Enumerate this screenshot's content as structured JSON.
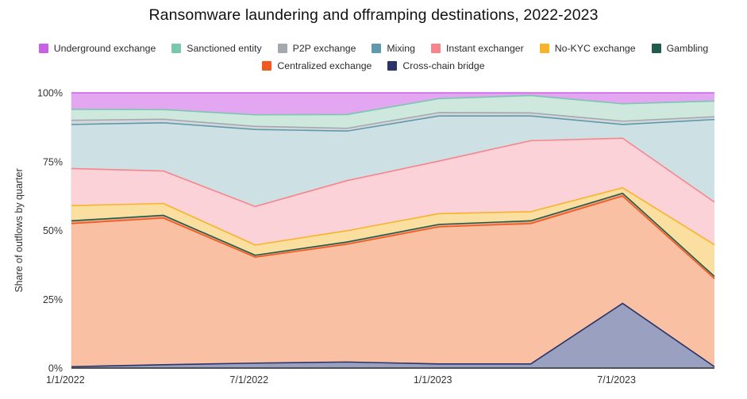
{
  "title": "Ransomware laundering and offramping destinations, 2022-2023",
  "legend": {
    "rows": [
      [
        {
          "label": "Underground exchange",
          "color": "#c961e8",
          "key": "underground_exchange"
        },
        {
          "label": "Sanctioned entity",
          "color": "#79c8ae",
          "key": "sanctioned_entity"
        },
        {
          "label": "P2P exchange",
          "color": "#a3a9ae",
          "key": "p2p_exchange"
        },
        {
          "label": "Mixing",
          "color": "#5f9aac",
          "key": "mixing"
        },
        {
          "label": "Instant exchanger",
          "color": "#f8848c",
          "key": "instant_exchanger"
        },
        {
          "label": "No-KYC exchange",
          "color": "#f7b32b",
          "key": "no_kyc_exchange"
        },
        {
          "label": "Gambling",
          "color": "#1f5c4d",
          "key": "gambling"
        }
      ],
      [
        {
          "label": "Centralized exchange",
          "color": "#f05a1e",
          "key": "centralized_exchange"
        },
        {
          "label": "Cross-chain bridge",
          "color": "#2b3468",
          "key": "cross_chain_bridge"
        }
      ]
    ]
  },
  "axes": {
    "y_title": "Share of outflows by quarter",
    "y_ticks": [
      "0%",
      "25%",
      "50%",
      "75%",
      "100%"
    ],
    "y_tick_values": [
      0,
      25,
      50,
      75,
      100
    ],
    "y_min": 0,
    "y_max": 100,
    "x_ticks": [
      "1/1/2022",
      "7/1/2022",
      "1/1/2023",
      "7/1/2023"
    ],
    "x_tick_indices": [
      0,
      2,
      4,
      6
    ]
  },
  "chart_data": {
    "type": "area",
    "stacked": true,
    "title": "Ransomware laundering and offramping destinations, 2022-2023",
    "xlabel": "",
    "ylabel": "Share of outflows by quarter",
    "ylim": [
      0,
      100
    ],
    "grid": true,
    "legend_position": "top",
    "x": [
      "1/1/2022",
      "4/1/2022",
      "7/1/2022",
      "10/1/2022",
      "1/1/2023",
      "4/1/2023",
      "7/1/2023",
      "10/1/2023"
    ],
    "x_tick_labels": [
      "1/1/2022",
      "7/1/2022",
      "1/1/2023",
      "7/1/2023"
    ],
    "stack_order_bottom_to_top": [
      "cross_chain_bridge",
      "centralized_exchange",
      "gambling",
      "no_kyc_exchange",
      "instant_exchanger",
      "mixing",
      "p2p_exchange",
      "sanctioned_entity",
      "underground_exchange"
    ],
    "series": [
      {
        "name": "Cross-chain bridge",
        "key": "cross_chain_bridge",
        "color": "#2b3468",
        "fill": "#9aa0c0",
        "values": [
          0.5,
          1.2,
          1.8,
          2.2,
          1.5,
          1.5,
          23.5,
          0.5
        ]
      },
      {
        "name": "Centralized exchange",
        "key": "centralized_exchange",
        "color": "#f05a1e",
        "fill": "#fac0a4",
        "values": [
          52.0,
          53.3,
          38.5,
          42.8,
          49.8,
          51.0,
          39.0,
          32.0
        ]
      },
      {
        "name": "Gambling",
        "key": "gambling",
        "color": "#1f5c4d",
        "fill": "#e9a07e",
        "values": [
          1.0,
          1.0,
          0.7,
          0.8,
          0.9,
          1.0,
          1.0,
          0.8
        ]
      },
      {
        "name": "No-KYC exchange",
        "key": "no_kyc_exchange",
        "color": "#f7b32b",
        "fill": "#fbdfa1",
        "values": [
          5.5,
          4.3,
          3.7,
          4.1,
          3.9,
          3.3,
          2.0,
          11.5
        ]
      },
      {
        "name": "Instant exchanger",
        "key": "instant_exchanger",
        "color": "#f8848c",
        "fill": "#fbd2d8",
        "values": [
          13.5,
          11.8,
          14.0,
          18.2,
          19.1,
          25.8,
          18.0,
          15.5
        ]
      },
      {
        "name": "Mixing",
        "key": "mixing",
        "color": "#5f9aac",
        "fill": "#cde0e4",
        "values": [
          16.0,
          17.5,
          28.0,
          18.0,
          16.4,
          9.0,
          5.0,
          30.0
        ]
      },
      {
        "name": "P2P exchange",
        "key": "p2p_exchange",
        "color": "#a3a9ae",
        "fill": "#d4d8db",
        "values": [
          1.5,
          1.3,
          1.1,
          1.0,
          1.2,
          1.1,
          1.2,
          1.0
        ]
      },
      {
        "name": "Sanctioned entity",
        "key": "sanctioned_entity",
        "color": "#79c8ae",
        "fill": "#cfe8dd",
        "values": [
          4.0,
          3.5,
          4.2,
          5.0,
          5.1,
          6.3,
          6.3,
          5.7
        ]
      },
      {
        "name": "Underground exchange",
        "key": "underground_exchange",
        "color": "#c961e8",
        "fill": "#e3a7f2",
        "values": [
          6.0,
          6.1,
          8.0,
          7.9,
          2.1,
          1.0,
          4.0,
          3.0
        ]
      }
    ]
  },
  "colors": {
    "plot_background": "#ffffff",
    "gridline": "#d8d8d8",
    "axis_line": "#333333",
    "text": "#333333"
  }
}
